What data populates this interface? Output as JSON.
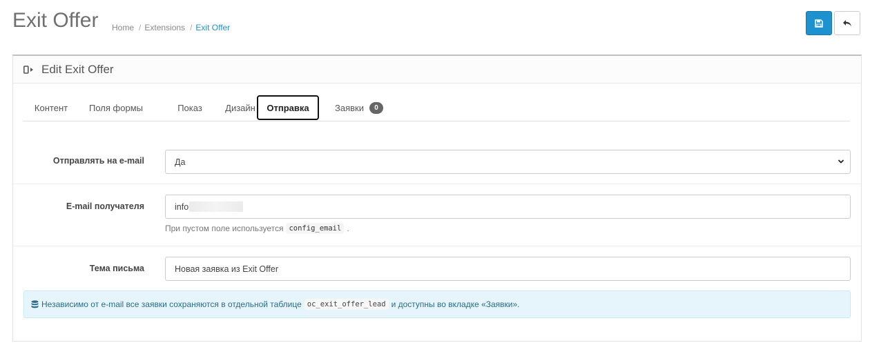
{
  "header": {
    "title": "Exit Offer",
    "breadcrumb": [
      "Home",
      "Extensions",
      "Exit Offer"
    ],
    "buttons": {
      "save_icon": "floppy-disk-icon",
      "back_icon": "reply-arrow-icon"
    },
    "accent": "#1e91cf"
  },
  "panel": {
    "icon": "sign-out-icon",
    "title": "Edit Exit Offer"
  },
  "tabs": [
    {
      "label": "Контент"
    },
    {
      "label": "Поля формы"
    },
    {
      "label": "Показ"
    },
    {
      "label": "Дизайн"
    },
    {
      "label": "Отправка",
      "active": true
    },
    {
      "label": "Заявки",
      "badge": "0"
    }
  ],
  "form": {
    "send_email": {
      "label": "Отправлять на e-mail",
      "value": "Да"
    },
    "recipient": {
      "label": "E-mail получателя",
      "value_visible": "info",
      "help_before": "При пустом поле используется",
      "help_code": "config_email",
      "help_after": "."
    },
    "subject": {
      "label": "Тема письма",
      "value": "Новая заявка из Exit Offer"
    }
  },
  "alert": {
    "icon": "database-icon",
    "text_before": "Независимо от e-mail все заявки сохраняются в отдельной таблице",
    "code": "oc_exit_offer_lead",
    "text_after": "и доступны во вкладке «Заявки»."
  }
}
